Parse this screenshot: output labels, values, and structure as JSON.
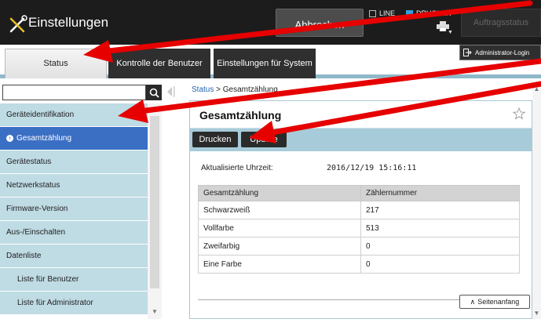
{
  "header": {
    "title": "Einstellungen",
    "cancel_label": "Abbrechen",
    "printer_tabs": {
      "line": "LINE",
      "drucker": "DRUCKER"
    },
    "job_status_label": "Auftragsstatus"
  },
  "tabs": [
    {
      "label": "Status"
    },
    {
      "label": "Kontrolle der Benutzer"
    },
    {
      "label": "Einstellungen für System"
    }
  ],
  "logout_label": "Administrator-Login",
  "sidebar": {
    "search_placeholder": "",
    "items": [
      {
        "label": "Geräteidentifikation"
      },
      {
        "label": "Gesamtzählung"
      },
      {
        "label": "Gerätestatus"
      },
      {
        "label": "Netzwerkstatus"
      },
      {
        "label": "Firmware-Version"
      },
      {
        "label": "Aus-/Einschalten"
      },
      {
        "label": "Datenliste"
      },
      {
        "label": "Liste für Benutzer"
      },
      {
        "label": "Liste für Administrator"
      }
    ]
  },
  "breadcrumb": {
    "root": "Status",
    "separator": ">",
    "current": "Gesamtzählung"
  },
  "panel": {
    "title": "Gesamtzählung",
    "print_label": "Drucken",
    "update_label": "Update",
    "updated_label": "Aktualisierte Uhrzeit:",
    "updated_value": "2016/12/19 15:16:11",
    "columns": [
      "Gesamtzählung",
      "Zählernummer"
    ],
    "rows": [
      [
        "Schwarzweiß",
        "217"
      ],
      [
        "Vollfarbe",
        "513"
      ],
      [
        "Zweifarbig",
        "0"
      ],
      [
        "Eine Farbe",
        "0"
      ]
    ],
    "top_label": "Seitenanfang"
  },
  "colors": {
    "accent_blue": "#3a6fc4",
    "nav_bg": "#bfdbe4",
    "arrow_red": "#e60000"
  }
}
